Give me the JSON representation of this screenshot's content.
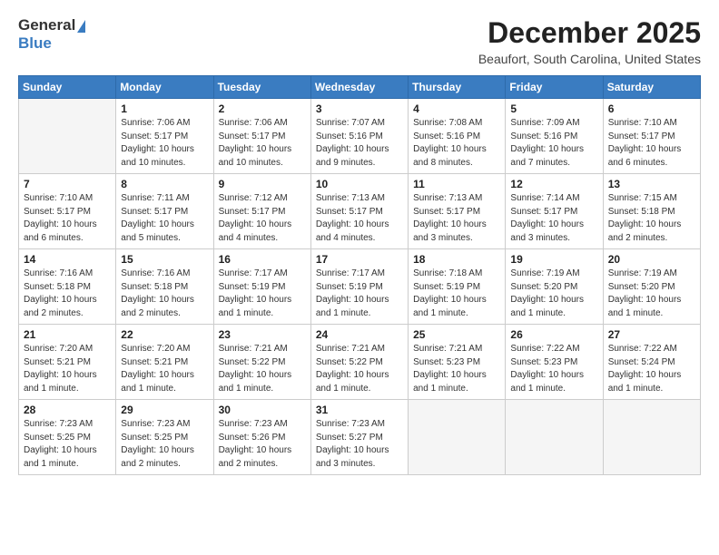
{
  "logo": {
    "general": "General",
    "blue": "Blue"
  },
  "header": {
    "month": "December 2025",
    "location": "Beaufort, South Carolina, United States"
  },
  "weekdays": [
    "Sunday",
    "Monday",
    "Tuesday",
    "Wednesday",
    "Thursday",
    "Friday",
    "Saturday"
  ],
  "weeks": [
    [
      {
        "day": "",
        "info": ""
      },
      {
        "day": "1",
        "info": "Sunrise: 7:06 AM\nSunset: 5:17 PM\nDaylight: 10 hours\nand 10 minutes."
      },
      {
        "day": "2",
        "info": "Sunrise: 7:06 AM\nSunset: 5:17 PM\nDaylight: 10 hours\nand 10 minutes."
      },
      {
        "day": "3",
        "info": "Sunrise: 7:07 AM\nSunset: 5:16 PM\nDaylight: 10 hours\nand 9 minutes."
      },
      {
        "day": "4",
        "info": "Sunrise: 7:08 AM\nSunset: 5:16 PM\nDaylight: 10 hours\nand 8 minutes."
      },
      {
        "day": "5",
        "info": "Sunrise: 7:09 AM\nSunset: 5:16 PM\nDaylight: 10 hours\nand 7 minutes."
      },
      {
        "day": "6",
        "info": "Sunrise: 7:10 AM\nSunset: 5:17 PM\nDaylight: 10 hours\nand 6 minutes."
      }
    ],
    [
      {
        "day": "7",
        "info": "Sunrise: 7:10 AM\nSunset: 5:17 PM\nDaylight: 10 hours\nand 6 minutes."
      },
      {
        "day": "8",
        "info": "Sunrise: 7:11 AM\nSunset: 5:17 PM\nDaylight: 10 hours\nand 5 minutes."
      },
      {
        "day": "9",
        "info": "Sunrise: 7:12 AM\nSunset: 5:17 PM\nDaylight: 10 hours\nand 4 minutes."
      },
      {
        "day": "10",
        "info": "Sunrise: 7:13 AM\nSunset: 5:17 PM\nDaylight: 10 hours\nand 4 minutes."
      },
      {
        "day": "11",
        "info": "Sunrise: 7:13 AM\nSunset: 5:17 PM\nDaylight: 10 hours\nand 3 minutes."
      },
      {
        "day": "12",
        "info": "Sunrise: 7:14 AM\nSunset: 5:17 PM\nDaylight: 10 hours\nand 3 minutes."
      },
      {
        "day": "13",
        "info": "Sunrise: 7:15 AM\nSunset: 5:18 PM\nDaylight: 10 hours\nand 2 minutes."
      }
    ],
    [
      {
        "day": "14",
        "info": "Sunrise: 7:16 AM\nSunset: 5:18 PM\nDaylight: 10 hours\nand 2 minutes."
      },
      {
        "day": "15",
        "info": "Sunrise: 7:16 AM\nSunset: 5:18 PM\nDaylight: 10 hours\nand 2 minutes."
      },
      {
        "day": "16",
        "info": "Sunrise: 7:17 AM\nSunset: 5:19 PM\nDaylight: 10 hours\nand 1 minute."
      },
      {
        "day": "17",
        "info": "Sunrise: 7:17 AM\nSunset: 5:19 PM\nDaylight: 10 hours\nand 1 minute."
      },
      {
        "day": "18",
        "info": "Sunrise: 7:18 AM\nSunset: 5:19 PM\nDaylight: 10 hours\nand 1 minute."
      },
      {
        "day": "19",
        "info": "Sunrise: 7:19 AM\nSunset: 5:20 PM\nDaylight: 10 hours\nand 1 minute."
      },
      {
        "day": "20",
        "info": "Sunrise: 7:19 AM\nSunset: 5:20 PM\nDaylight: 10 hours\nand 1 minute."
      }
    ],
    [
      {
        "day": "21",
        "info": "Sunrise: 7:20 AM\nSunset: 5:21 PM\nDaylight: 10 hours\nand 1 minute."
      },
      {
        "day": "22",
        "info": "Sunrise: 7:20 AM\nSunset: 5:21 PM\nDaylight: 10 hours\nand 1 minute."
      },
      {
        "day": "23",
        "info": "Sunrise: 7:21 AM\nSunset: 5:22 PM\nDaylight: 10 hours\nand 1 minute."
      },
      {
        "day": "24",
        "info": "Sunrise: 7:21 AM\nSunset: 5:22 PM\nDaylight: 10 hours\nand 1 minute."
      },
      {
        "day": "25",
        "info": "Sunrise: 7:21 AM\nSunset: 5:23 PM\nDaylight: 10 hours\nand 1 minute."
      },
      {
        "day": "26",
        "info": "Sunrise: 7:22 AM\nSunset: 5:23 PM\nDaylight: 10 hours\nand 1 minute."
      },
      {
        "day": "27",
        "info": "Sunrise: 7:22 AM\nSunset: 5:24 PM\nDaylight: 10 hours\nand 1 minute."
      }
    ],
    [
      {
        "day": "28",
        "info": "Sunrise: 7:23 AM\nSunset: 5:25 PM\nDaylight: 10 hours\nand 1 minute."
      },
      {
        "day": "29",
        "info": "Sunrise: 7:23 AM\nSunset: 5:25 PM\nDaylight: 10 hours\nand 2 minutes."
      },
      {
        "day": "30",
        "info": "Sunrise: 7:23 AM\nSunset: 5:26 PM\nDaylight: 10 hours\nand 2 minutes."
      },
      {
        "day": "31",
        "info": "Sunrise: 7:23 AM\nSunset: 5:27 PM\nDaylight: 10 hours\nand 3 minutes."
      },
      {
        "day": "",
        "info": ""
      },
      {
        "day": "",
        "info": ""
      },
      {
        "day": "",
        "info": ""
      }
    ]
  ]
}
